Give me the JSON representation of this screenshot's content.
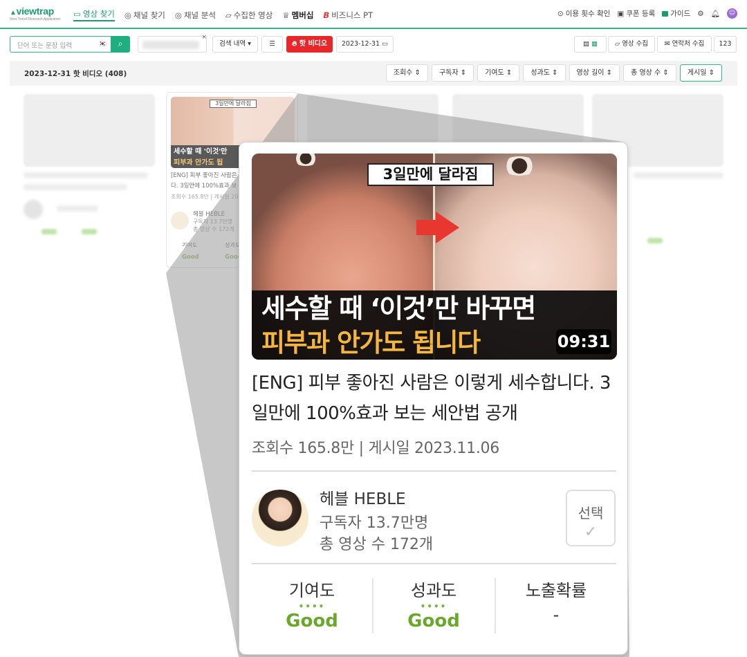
{
  "nav": {
    "logo": "viewtrap",
    "logo_sub": "View Trend Research Application",
    "tabs": [
      {
        "label": "영상 찾기"
      },
      {
        "label": "채널 찾기"
      },
      {
        "label": "채널 분석"
      },
      {
        "label": "수집한 영상"
      },
      {
        "label": "멤버십"
      },
      {
        "label": "비즈니스 PT"
      }
    ],
    "right": {
      "usage": "이용 횟수 확인",
      "coupon": "쿠폰 등록",
      "guide": "가이드"
    }
  },
  "toolbar": {
    "search_placeholder": "단어 또는 문장 입력",
    "flag": "🇰🇷",
    "history": "검색 내역 ▾",
    "hot_video": "핫 비디오",
    "date": "2023-12-31",
    "collect_video": "영상 수집",
    "collect_contact": "연락처 수집",
    "count": "123"
  },
  "results": {
    "title": "2023-12-31 핫 비디오 (408)",
    "sorts": [
      "조회수",
      "구독자",
      "기여도",
      "성과도",
      "영상 길이",
      "총 영상 수",
      "게시일"
    ]
  },
  "small_card": {
    "tag": "3일만에 달라짐",
    "cap1": "세수할 때 '이것'만",
    "cap2": "피부과 안가도 됩",
    "title1": "[ENG] 피부 좋아진 사람은",
    "title2": "다. 3일만에 100%효과 보",
    "meta": "조회수 165.8만 | 게시일 202",
    "channel": "헤블 HEBLE",
    "subs": "구독자 13.7만명",
    "videos": "총 영상 수 172개",
    "m1": "기여도",
    "m1v": "Good",
    "m2": "성과도",
    "m2v": "Good"
  },
  "card": {
    "thumb_tag": "3일만에 달라짐",
    "caption1": "세수할 때 ‘이것’만 바꾸면",
    "caption2": "피부과 안가도 됩니다",
    "duration": "09:31",
    "title": "[ENG] 피부 좋아진 사람은 이렇게 세수합니다. 3일만에 100%효과 보는 세안법 공개",
    "meta": "조회수 165.8만 | 게시일 2023.11.06",
    "channel_name": "헤블 HEBLE",
    "subscribers": "구독자 13.7만명",
    "total_videos": "총 영상 수 172개",
    "select_label": "선택",
    "metrics": [
      {
        "label": "기여도",
        "dots": "••••",
        "value": "Good"
      },
      {
        "label": "성과도",
        "dots": "••••",
        "value": "Good"
      },
      {
        "label": "노출확률",
        "dots": "",
        "value": "-"
      }
    ]
  },
  "colors": {
    "brand": "#1a9e6e",
    "hot": "#e8272b",
    "good": "#6aa82b",
    "caption_yellow": "#f5b63d"
  }
}
